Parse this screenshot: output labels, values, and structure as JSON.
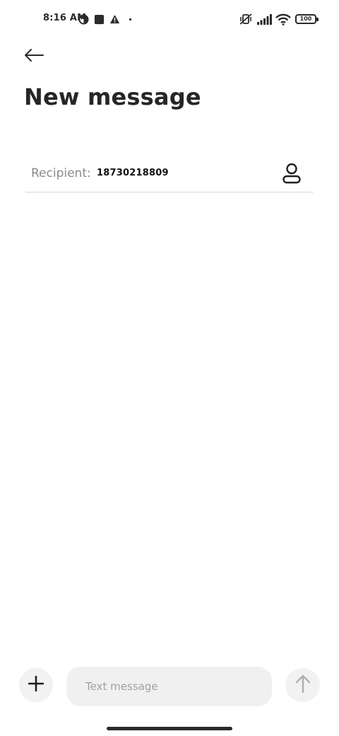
{
  "status_bar": {
    "time": "8:16 AM",
    "battery": "100",
    "icons": [
      "data-saver-icon",
      "app-square-icon",
      "alert-icon",
      "dot-icon",
      "vibrate-off-icon",
      "signal-icon",
      "wifi-icon",
      "battery-icon"
    ]
  },
  "header": {
    "back_icon": "arrow-left-icon",
    "title": "New message"
  },
  "recipient": {
    "label": "Recipient:",
    "value": "18730218809",
    "contact_icon": "person-icon"
  },
  "composer": {
    "add_icon": "plus-icon",
    "placeholder": "Text message",
    "send_icon": "arrow-up-icon"
  },
  "colors": {
    "background": "#ffffff",
    "text": "#262626",
    "muted": "#8a8a8a",
    "field": "#f0f0f0",
    "divider": "#d8d8d8"
  }
}
